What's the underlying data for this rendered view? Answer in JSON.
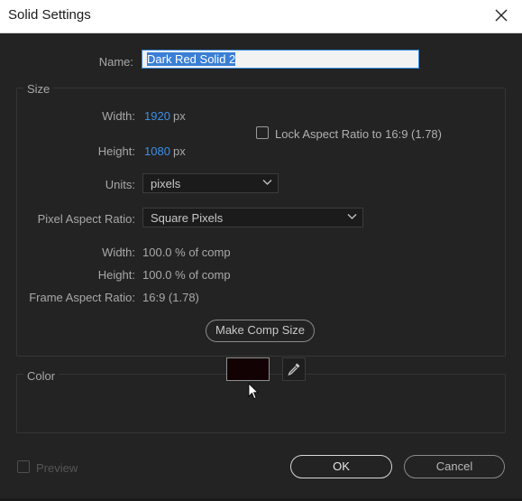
{
  "window": {
    "title": "Solid Settings",
    "close_icon": "close-icon"
  },
  "name": {
    "label": "Name:",
    "value": "Dark Red Solid 2"
  },
  "size": {
    "group_title": "Size",
    "width_label": "Width:",
    "width_value": "1920",
    "width_unit": "px",
    "height_label": "Height:",
    "height_value": "1080",
    "height_unit": "px",
    "lock_aspect_label": "Lock Aspect Ratio to 16:9 (1.78)",
    "lock_aspect_checked": false,
    "units_label": "Units:",
    "units_value": "pixels",
    "par_label": "Pixel Aspect Ratio:",
    "par_value": "Square Pixels",
    "comp_width_label": "Width:",
    "comp_width_value": "100.0 % of comp",
    "comp_height_label": "Height:",
    "comp_height_value": "100.0 % of comp",
    "frame_aspect_label": "Frame Aspect Ratio:",
    "frame_aspect_value": "16:9 (1.78)",
    "make_comp_size_label": "Make Comp Size"
  },
  "color": {
    "group_title": "Color",
    "swatch_hex": "#120203",
    "eyedropper_icon": "eyedropper-icon"
  },
  "footer": {
    "preview_label": "Preview",
    "preview_checked": false,
    "ok_label": "OK",
    "cancel_label": "Cancel"
  },
  "colors": {
    "accent": "#3d8ee6",
    "background": "#232323"
  }
}
